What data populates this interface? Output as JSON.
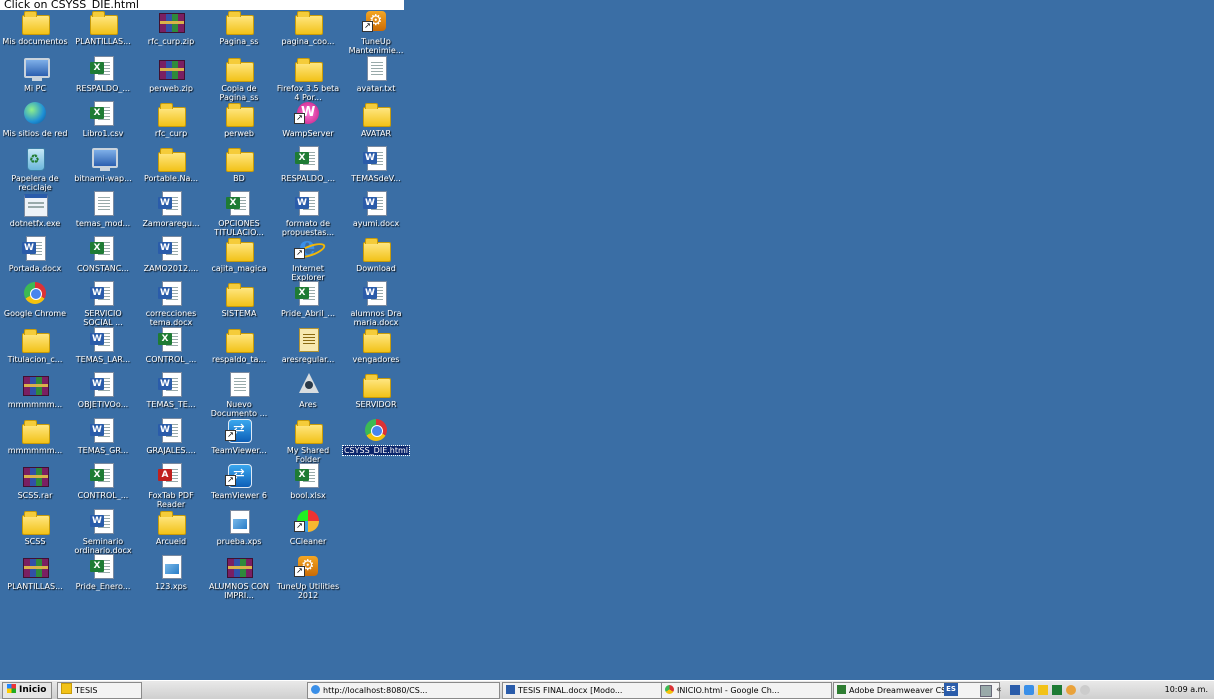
{
  "caption": "Click on CSYSS_DIE.html",
  "desktop_icons": [
    {
      "label": "Mis documentos",
      "icon": "folder"
    },
    {
      "label": "PLANTILLAS...",
      "icon": "folder"
    },
    {
      "label": "rfc_curp.zip",
      "icon": "rar"
    },
    {
      "label": "Pagina_ss",
      "icon": "folder"
    },
    {
      "label": "pagina_coo...",
      "icon": "folder"
    },
    {
      "label": "TuneUp Mantenimie...",
      "icon": "tuneup"
    },
    {
      "label": "Mi PC",
      "icon": "monitor"
    },
    {
      "label": "RESPALDO_...",
      "icon": "excel"
    },
    {
      "label": "perweb.zip",
      "icon": "rar"
    },
    {
      "label": "Copia de Pagina_ss",
      "icon": "folder"
    },
    {
      "label": "Firefox 3.5 beta 4 Por...",
      "icon": "folder"
    },
    {
      "label": "avatar.txt",
      "icon": "page"
    },
    {
      "label": "Mis sitios de red",
      "icon": "globe"
    },
    {
      "label": "Libro1.csv",
      "icon": "excel"
    },
    {
      "label": "rfc_curp",
      "icon": "folder"
    },
    {
      "label": "perweb",
      "icon": "folder"
    },
    {
      "label": "WampServer",
      "icon": "wamp"
    },
    {
      "label": "AVATAR",
      "icon": "folder"
    },
    {
      "label": "Papelera de reciclaje",
      "icon": "recycle"
    },
    {
      "label": "bitnami-wap...",
      "icon": "monitor"
    },
    {
      "label": "Portable.Na...",
      "icon": "folder"
    },
    {
      "label": "BD",
      "icon": "folder"
    },
    {
      "label": "RESPALDO_...",
      "icon": "excel"
    },
    {
      "label": "TEMASdeV...",
      "icon": "word"
    },
    {
      "label": "dotnetfx.exe",
      "icon": "exe"
    },
    {
      "label": "temas_mod...",
      "icon": "page"
    },
    {
      "label": "Zamoraregu...",
      "icon": "word"
    },
    {
      "label": "OPCIONES TITULACIO...",
      "icon": "excel"
    },
    {
      "label": "formato de propuestas...",
      "icon": "word"
    },
    {
      "label": "ayumi.docx",
      "icon": "word"
    },
    {
      "label": "Portada.docx",
      "icon": "word"
    },
    {
      "label": "CONSTANC...",
      "icon": "excel"
    },
    {
      "label": "ZAMO2012....",
      "icon": "word"
    },
    {
      "label": "cajita_magica",
      "icon": "folder"
    },
    {
      "label": "Internet Explorer",
      "icon": "ie"
    },
    {
      "label": "Download",
      "icon": "folder"
    },
    {
      "label": "Google Chrome",
      "icon": "chrome"
    },
    {
      "label": "SERVICIO SOCIAL ...",
      "icon": "word"
    },
    {
      "label": "correcciones tema.docx",
      "icon": "word"
    },
    {
      "label": "SISTEMA",
      "icon": "folder"
    },
    {
      "label": "Pride_Abril_...",
      "icon": "excel"
    },
    {
      "label": "alumnos Dra maria.docx",
      "icon": "word"
    },
    {
      "label": "Titulacion_c...",
      "icon": "folder"
    },
    {
      "label": "TEMAS_LAR...",
      "icon": "word"
    },
    {
      "label": "CONTROL_...",
      "icon": "excel"
    },
    {
      "label": "respaldo_ta...",
      "icon": "folder"
    },
    {
      "label": "aresregular...",
      "icon": "yellow"
    },
    {
      "label": "vengadores",
      "icon": "folder"
    },
    {
      "label": "mmmmmm...",
      "icon": "rar"
    },
    {
      "label": "OBJETIVOo...",
      "icon": "word"
    },
    {
      "label": "TEMAS_TE...",
      "icon": "word"
    },
    {
      "label": "Nuevo Documento ...",
      "icon": "page"
    },
    {
      "label": "Ares",
      "icon": "ares"
    },
    {
      "label": "SERVIDOR",
      "icon": "folder"
    },
    {
      "label": "mmmmmm...",
      "icon": "folder"
    },
    {
      "label": "TEMAS_GR...",
      "icon": "word"
    },
    {
      "label": "GRAJALES....",
      "icon": "word"
    },
    {
      "label": "TeamViewer...",
      "icon": "tv"
    },
    {
      "label": "My Shared Folder",
      "icon": "folder"
    },
    {
      "label": "CSYSS_DIE.html",
      "icon": "chrome",
      "selected": true
    },
    {
      "label": "SCSS.rar",
      "icon": "rar"
    },
    {
      "label": "CONTROL_...",
      "icon": "excel"
    },
    {
      "label": "FoxTab PDF Reader",
      "icon": "pdf"
    },
    {
      "label": "TeamViewer 6",
      "icon": "tv"
    },
    {
      "label": "bool.xlsx",
      "icon": "excel"
    },
    {
      "label": "SCSS",
      "icon": "folder"
    },
    {
      "label": "Seminario ordinario.docx",
      "icon": "word"
    },
    {
      "label": "Arcueid",
      "icon": "folder"
    },
    {
      "label": "prueba.xps",
      "icon": "xps"
    },
    {
      "label": "CCleaner",
      "icon": "cc"
    },
    {
      "label": "PLANTILLAS...",
      "icon": "rar"
    },
    {
      "label": "Pride_Enero...",
      "icon": "excel"
    },
    {
      "label": "123.xps",
      "icon": "xps"
    },
    {
      "label": "ALUMNOS CON IMPRI...",
      "icon": "rar"
    },
    {
      "label": "TuneUp Utilities 2012",
      "icon": "tuneup"
    }
  ],
  "taskbar": {
    "start_label": "Inicio",
    "buttons": [
      {
        "label": "TESIS",
        "icon": "folder-icon"
      },
      {
        "label": "http://localhost:8080/CS...",
        "icon": "ie-icon"
      },
      {
        "label": "TESIS FINAL.docx [Modo...",
        "icon": "word-icon"
      },
      {
        "label": "INICIO.html - Google Ch...",
        "icon": "chrome-icon"
      },
      {
        "label": "Adobe Dreamweaver CS...",
        "icon": "dreamweaver-icon"
      }
    ],
    "language": "ES",
    "clock": "10:09 a.m."
  },
  "colors": {
    "desktop": "#3a6ea5",
    "selection": "#0a246a"
  }
}
